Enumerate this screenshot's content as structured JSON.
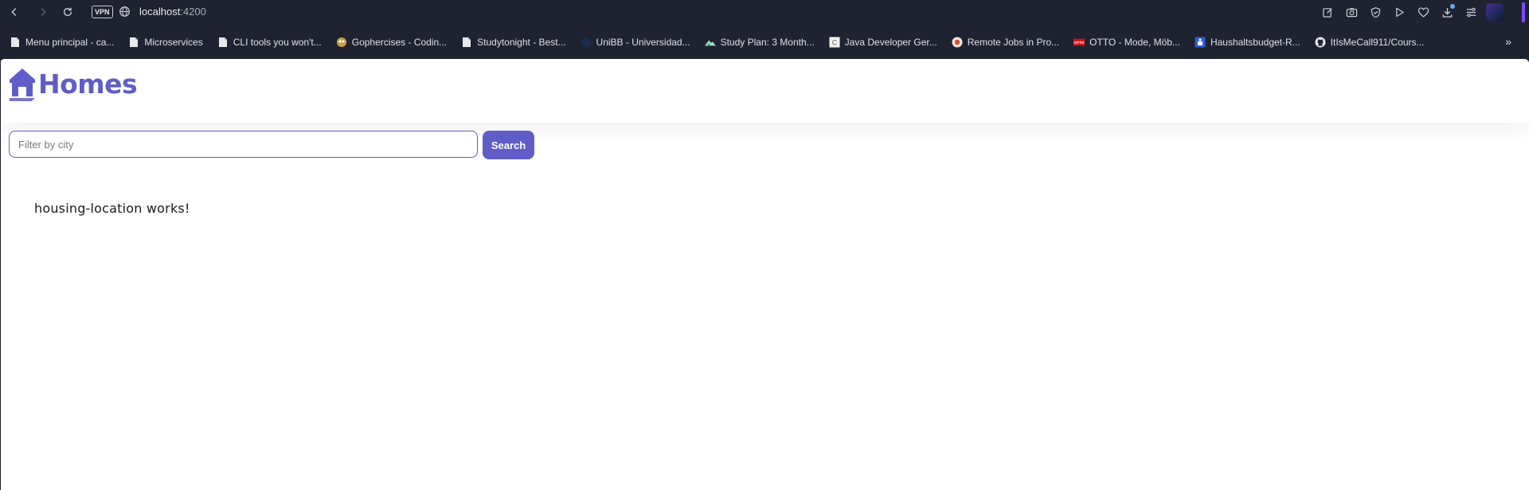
{
  "browser": {
    "vpn_label": "VPN",
    "address_host": "localhost",
    "address_port": ":4200",
    "accent_color": "#7b4dff",
    "toolbar_icons": [
      "back-icon",
      "forward-icon",
      "reload-icon",
      "edit-icon",
      "camera-icon",
      "shield-icon",
      "play-icon",
      "heart-icon",
      "download-icon",
      "menu-icon"
    ]
  },
  "bookmarks": {
    "items": [
      {
        "label": "Menu principal - ca...",
        "icon": "page-icon"
      },
      {
        "label": "Microservices",
        "icon": "page-icon"
      },
      {
        "label": "CLI tools you won't...",
        "icon": "page-icon"
      },
      {
        "label": "Gophercises - Codin...",
        "icon": "gopher-icon"
      },
      {
        "label": "Studytonight - Best...",
        "icon": "page-icon"
      },
      {
        "label": "UniBB - Universidad...",
        "icon": "unibb-icon"
      },
      {
        "label": "Study Plan: 3 Month...",
        "icon": "mountain-icon"
      },
      {
        "label": "Java Developer Ger...",
        "icon": "c-icon"
      },
      {
        "label": "Remote Jobs in Pro...",
        "icon": "remote-icon"
      },
      {
        "label": "OTTO - Mode, Möb...",
        "icon": "otto-icon"
      },
      {
        "label": "Haushaltsbudget-R...",
        "icon": "bank-icon"
      },
      {
        "label": "ItIsMeCall911/Cours...",
        "icon": "github-icon"
      }
    ],
    "more_label": "»"
  },
  "app": {
    "brand": "Homes",
    "brand_color": "#605dc8",
    "search_placeholder": "Filter by city",
    "search_value": "",
    "search_button": "Search",
    "content_text": "housing-location works!"
  }
}
